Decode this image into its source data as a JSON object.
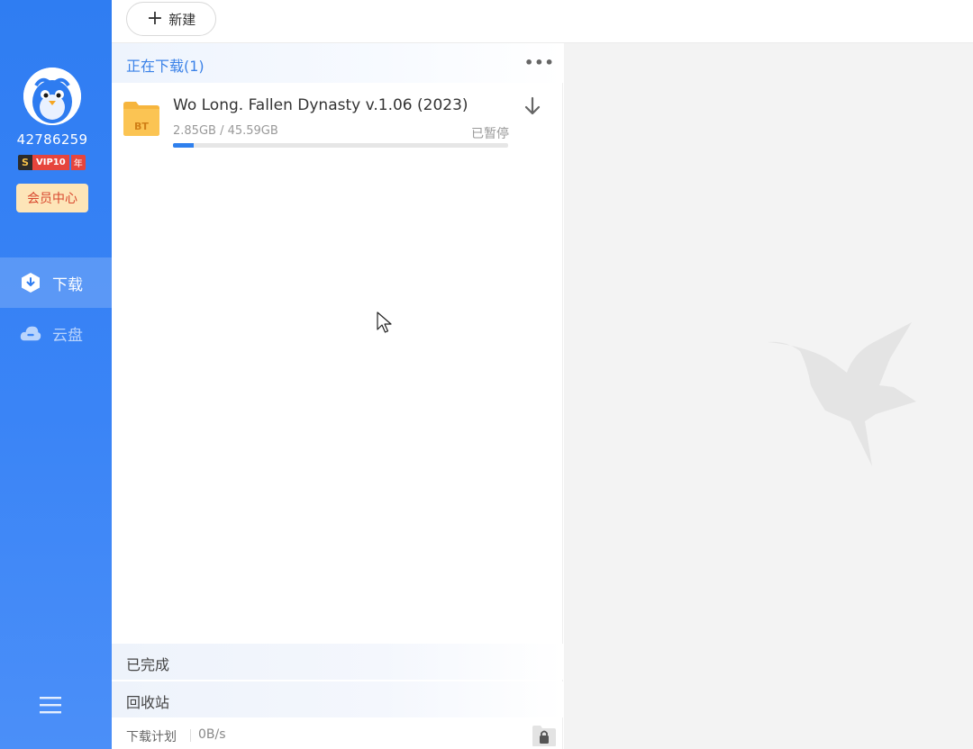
{
  "sidebar": {
    "user_id": "42786259",
    "vip": {
      "s": "S",
      "level": "VIP10",
      "year": "年"
    },
    "member_center": "会员中心",
    "nav": [
      {
        "label": "下载",
        "icon": "download-shield-icon",
        "active": true
      },
      {
        "label": "云盘",
        "icon": "cloud-icon",
        "active": false
      }
    ],
    "menu_icon": "hamburger-menu-icon"
  },
  "topbar": {
    "new_button": {
      "icon": "plus-icon",
      "label": "新建"
    }
  },
  "downloading": {
    "title": "正在下载(1)",
    "more_icon": "ellipsis-icon",
    "tasks": [
      {
        "icon": "bt-folder-icon",
        "icon_text": "BT",
        "name": "Wo Long. Fallen Dynasty v.1.06 (2023)",
        "size": "2.85GB / 45.59GB",
        "status": "已暂停",
        "progress": 0.0625,
        "action_icon": "download-arrow-icon"
      }
    ]
  },
  "groups": {
    "completed": "已完成",
    "recycle": "回收站"
  },
  "footer": {
    "plan": "下载计划",
    "speed": "0B/s",
    "lock_icon": "folder-lock-icon"
  },
  "colors": {
    "sidebar_blue": "#2f7df2",
    "accent_blue": "#3b82e8",
    "progress_blue": "#2f80ed",
    "bt_orange": "#f6b53d"
  }
}
